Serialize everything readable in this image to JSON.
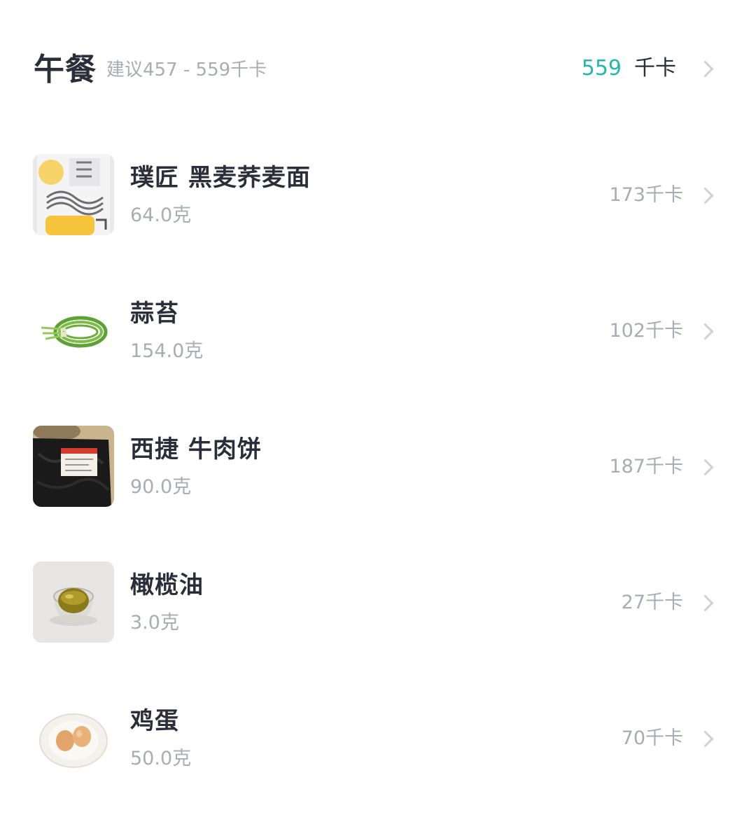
{
  "meal": {
    "title": "午餐",
    "suggestion": "建议457 - 559千卡",
    "total_value": "559",
    "total_unit": "千卡",
    "accent_color": "#23b9a8"
  },
  "items": [
    {
      "name": "璞匠 黑麦荞麦面",
      "weight": "64.0克",
      "kcal": "173千卡",
      "image": "noodle-package-photo"
    },
    {
      "name": "蒜苔",
      "weight": "154.0克",
      "kcal": "102千卡",
      "image": "garlic-scape-photo"
    },
    {
      "name": "西捷 牛肉饼",
      "weight": "90.0克",
      "kcal": "187千卡",
      "image": "beef-patty-package-photo"
    },
    {
      "name": "橄榄油",
      "weight": "3.0克",
      "kcal": "27千卡",
      "image": "olive-oil-bowl-photo"
    },
    {
      "name": "鸡蛋",
      "weight": "50.0克",
      "kcal": "70千卡",
      "image": "eggs-on-plate-photo"
    }
  ]
}
